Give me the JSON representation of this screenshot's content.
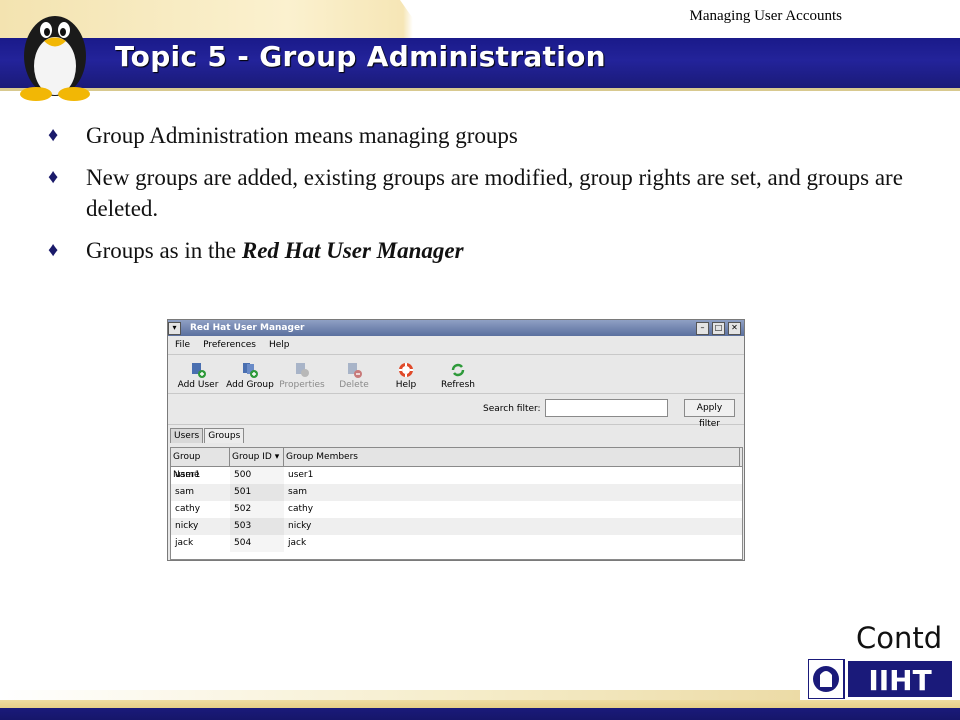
{
  "header": {
    "subtitle": "Managing User Accounts",
    "title": "Topic 5 - Group Administration"
  },
  "bullets": [
    {
      "text": "Group Administration means managing groups"
    },
    {
      "text": "New groups are added, existing groups are modified, group rights are set, and groups are deleted."
    },
    {
      "text_before": "Groups as in the ",
      "emphasis": "Red Hat User Manager"
    }
  ],
  "bullet_marker": "♦",
  "window": {
    "title": "Red Hat User Manager",
    "menu": [
      "File",
      "Preferences",
      "Help"
    ],
    "toolbar": [
      {
        "label": "Add User",
        "icon": "add-user-icon",
        "enabled": true
      },
      {
        "label": "Add Group",
        "icon": "add-group-icon",
        "enabled": true
      },
      {
        "label": "Properties",
        "icon": "properties-icon",
        "enabled": false
      },
      {
        "label": "Delete",
        "icon": "delete-icon",
        "enabled": false
      },
      {
        "label": "Help",
        "icon": "help-icon",
        "enabled": true
      },
      {
        "label": "Refresh",
        "icon": "refresh-icon",
        "enabled": true
      }
    ],
    "search_label": "Search filter:",
    "search_value": "",
    "apply_button": "Apply filter",
    "tabs": [
      {
        "label": "Users",
        "active": false
      },
      {
        "label": "Groups",
        "active": true
      }
    ],
    "columns": [
      "Group Name",
      "Group ID ▾",
      "Group Members"
    ],
    "rows": [
      [
        "user1",
        "500",
        "user1"
      ],
      [
        "sam",
        "501",
        "sam"
      ],
      [
        "cathy",
        "502",
        "cathy"
      ],
      [
        "nicky",
        "503",
        "nicky"
      ],
      [
        "jack",
        "504",
        "jack"
      ]
    ]
  },
  "footer": {
    "contd": "Contd",
    "logo_text": "IIHT"
  },
  "colors": {
    "header_blue": "#1a1a8a",
    "header_gold": "#f3e3b0",
    "title_text": "#ffffff"
  }
}
